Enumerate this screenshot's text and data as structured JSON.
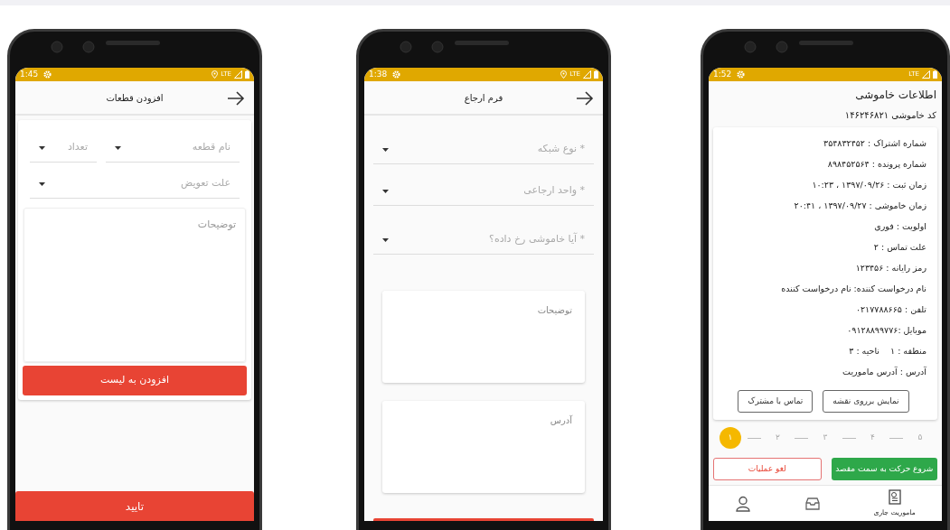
{
  "phones": [
    {
      "kind": "outage_info",
      "status_bar": {
        "time": "1:52",
        "network": "LTE",
        "location": false
      },
      "title": "اطلاعات خاموشی",
      "code": "کد خاموشی ۱۴۶۲۴۶۸۲۱",
      "details": [
        [
          "شماره اشتراک : ۳۵۴۸۳۲۴۵۲"
        ],
        [
          "شماره پرونده : ۸۹۸۴۵۲۵۶۴"
        ],
        [
          "زمان ثبت : ۱۳۹۷/۰۹/۲۶ ، ۱۰:۲۳"
        ],
        [
          "زمان خاموشی : ۱۳۹۷/۰۹/۲۷ ، ۲۰:۴۱"
        ],
        [
          "اولویت : فوری"
        ],
        [
          "علت تماس : ۲"
        ],
        [
          "رمز رایانه : ۱۲۳۴۵۶"
        ],
        [
          "نام درخواست کننده: نام درخواست کننده"
        ],
        [
          "تلفن : ۰۲۱۷۷۸۸۶۶۵"
        ],
        [
          "موبایل :۰۹۱۲۸۸۹۹۷۷۶"
        ],
        [
          "منطقه : ۱",
          "ناحیه : ۳"
        ],
        [
          "آدرس : آدرس ماموریت"
        ]
      ],
      "card_buttons": [
        "نمایش برروی نقشه",
        "تماس با مشترک"
      ],
      "steps": [
        {
          "label": "۵",
          "selected": false
        },
        {
          "label": "۴",
          "selected": false
        },
        {
          "label": "۳",
          "selected": false
        },
        {
          "label": "۲",
          "selected": false
        },
        {
          "label": "۱",
          "selected": true
        }
      ],
      "start_button": "شروع حرکت به سمت مقصد",
      "cancel_button": "لغو عملیات",
      "nav": [
        {
          "label": "ماموریت جاری",
          "selected": true
        },
        {
          "selected": false
        },
        {
          "selected": false
        }
      ]
    },
    {
      "kind": "referral_form",
      "status_bar": {
        "time": "1:38",
        "network": "LTE",
        "location": true
      },
      "header": {
        "title": "فرم ارجاع"
      },
      "selects": [
        {
          "placeholder": "* نوع شبکه"
        },
        {
          "placeholder": "* واحد ارجاعی"
        },
        {
          "placeholder": "* آیا خاموشی رخ داده؟"
        }
      ],
      "text_areas": [
        {
          "placeholder": "توضیحات"
        },
        {
          "placeholder": "آدرس"
        }
      ]
    },
    {
      "kind": "parts_form",
      "status_bar": {
        "time": "1:45",
        "network": "LTE",
        "location": true
      },
      "header": {
        "title": "افزودن قطعات"
      },
      "selects": [
        {
          "placeholder": "نام قطعه"
        },
        {
          "placeholder": "تعداد"
        },
        {
          "placeholder": "علت تعویض"
        }
      ],
      "notes": {
        "placeholder": "توضیحات"
      },
      "add_button": "افزودن به لیست",
      "confirm_button": "تایید"
    }
  ]
}
